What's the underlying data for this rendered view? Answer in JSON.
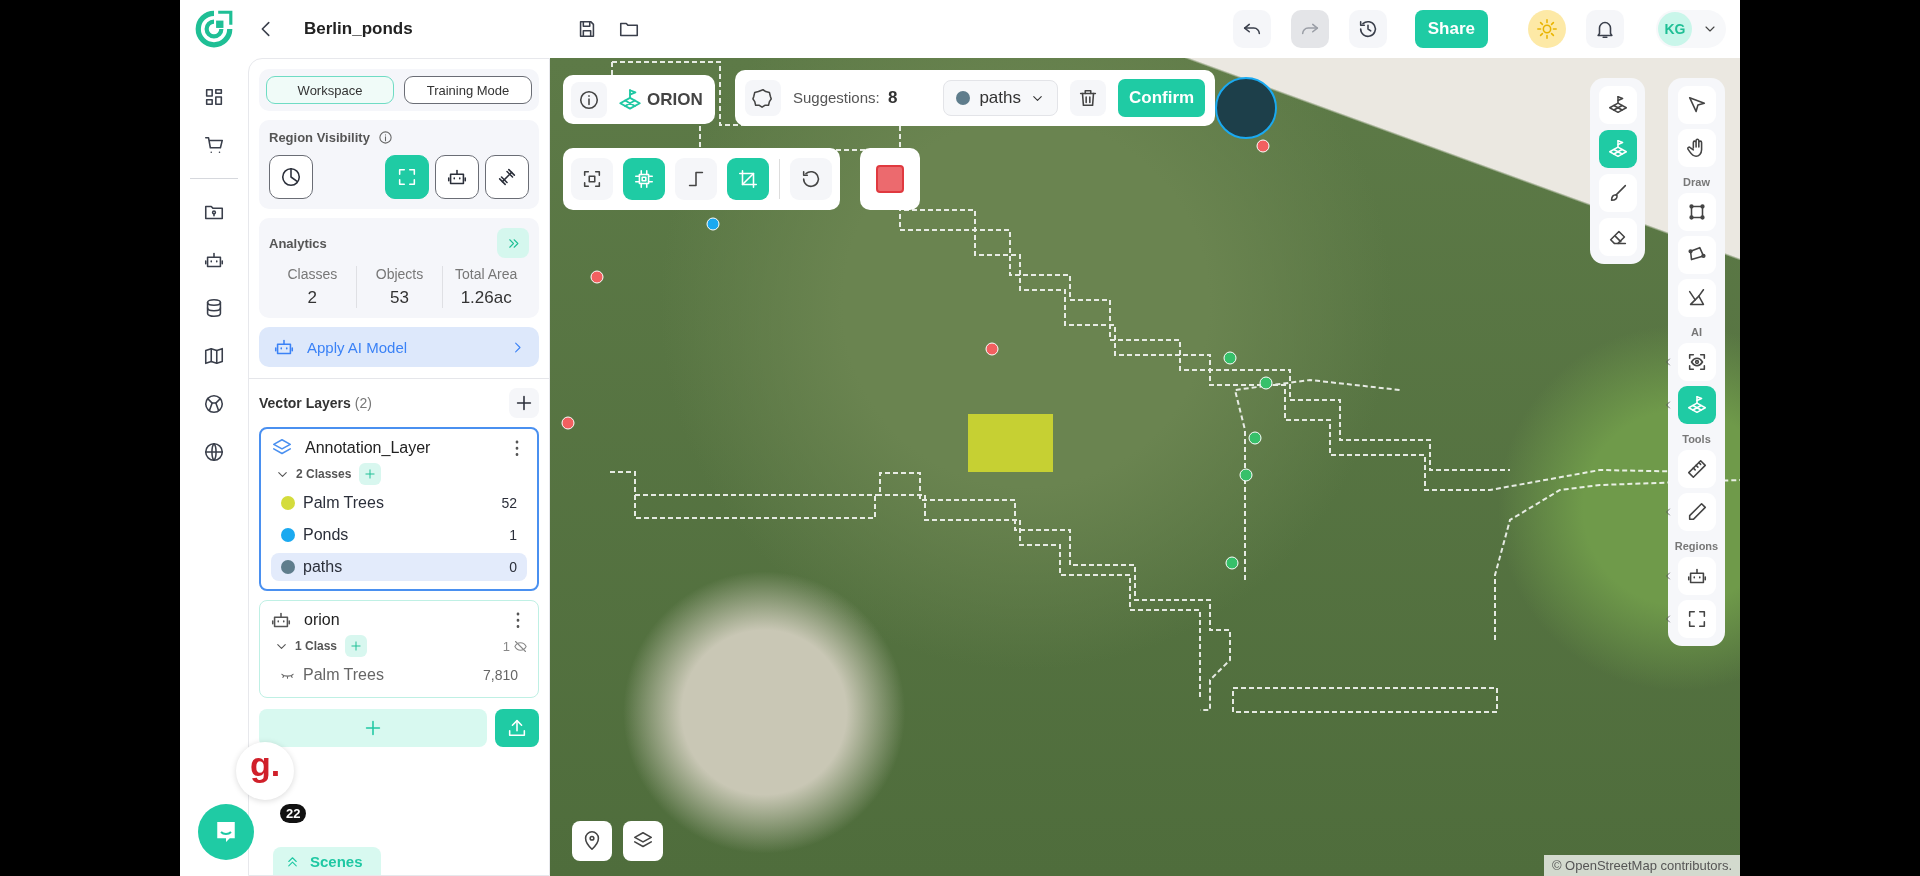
{
  "header": {
    "title": "Berlin_ponds"
  },
  "top_bar": {
    "actions": [
      {
        "kind": "undo",
        "disabled": false
      },
      {
        "kind": "redo",
        "disabled": true
      },
      {
        "kind": "history",
        "disabled": false
      }
    ],
    "share": "Share",
    "avatar": "KG"
  },
  "mode_tabs": [
    {
      "label": "Workspace",
      "selected": true
    },
    {
      "label": "Training Mode",
      "selected": false
    }
  ],
  "region_visibility": {
    "title": "Region Visibility",
    "tools": [
      {
        "kind": "pie",
        "selected": false
      },
      {
        "kind": "frame",
        "selected": true
      },
      {
        "kind": "robot",
        "selected": false
      },
      {
        "kind": "dumbbell",
        "selected": false
      }
    ]
  },
  "analytics": {
    "title": "Analytics",
    "stats": [
      {
        "label": "Classes",
        "value": "2"
      },
      {
        "label": "Objects",
        "value": "53"
      },
      {
        "label": "Total Area",
        "value": "1.26ac"
      }
    ]
  },
  "apply_model": {
    "label": "Apply AI Model"
  },
  "vector_layers": {
    "title": "Vector Layers",
    "count": "(2)",
    "layers": [
      {
        "kind": "annotation",
        "name": "Annotation_Layer",
        "selected": true,
        "class_count": "2 Classes",
        "classes": [
          {
            "name": "Palm Trees",
            "count": "52",
            "color": "#d4dc3c",
            "hidden": false,
            "selected": false
          },
          {
            "name": "Ponds",
            "count": "1",
            "color": "#1aa9f0",
            "hidden": false,
            "selected": false
          },
          {
            "name": "paths",
            "count": "0",
            "color": "#5f7d8c",
            "hidden": false,
            "selected": true
          }
        ]
      },
      {
        "kind": "model",
        "name": "orion",
        "selected": false,
        "class_count": "1 Class",
        "hidden_count": "1",
        "classes": [
          {
            "name": "Palm Trees",
            "count": "7,810",
            "hidden": true,
            "selected": false
          }
        ]
      }
    ]
  },
  "scenes": {
    "label": "Scenes"
  },
  "chat": {
    "extension_letter": "g.",
    "count": "22"
  },
  "map": {
    "orion": {
      "label": "ORION"
    },
    "suggestions": {
      "label": "Suggestions:",
      "count": "8",
      "class_select": {
        "label": "paths",
        "color": "#5f7d8c"
      },
      "confirm": "Confirm"
    },
    "tools": [
      {
        "kind": "focus",
        "selected": false
      },
      {
        "kind": "chip",
        "selected": true
      },
      {
        "kind": "step",
        "selected": false
      },
      {
        "kind": "crop",
        "selected": true
      },
      {
        "kind": "rotate",
        "selected": false
      }
    ],
    "side_tools": [
      {
        "kind": "flag",
        "selected": false
      },
      {
        "kind": "flag",
        "selected": true
      },
      {
        "kind": "brush",
        "selected": false
      },
      {
        "kind": "eraser",
        "selected": false
      }
    ],
    "toolbar_groups": [
      {
        "tools": [
          {
            "kind": "pointer",
            "selected": false,
            "submenu": false
          },
          {
            "kind": "hand",
            "selected": false,
            "submenu": false
          }
        ]
      },
      {
        "title": "Draw",
        "tools": [
          {
            "kind": "rect",
            "selected": false,
            "submenu": false
          },
          {
            "kind": "polygon",
            "selected": false,
            "submenu": false
          },
          {
            "kind": "polyline",
            "selected": false,
            "submenu": false
          }
        ]
      },
      {
        "title": "AI",
        "tools": [
          {
            "kind": "eyescan",
            "selected": false,
            "submenu": true
          },
          {
            "kind": "flag",
            "selected": true,
            "submenu": true
          }
        ]
      },
      {
        "title": "Tools",
        "tools": [
          {
            "kind": "ruler",
            "selected": false,
            "submenu": false
          },
          {
            "kind": "pen",
            "selected": false,
            "submenu": true
          }
        ]
      },
      {
        "title": "Regions",
        "tools": [
          {
            "kind": "robot",
            "selected": false,
            "submenu": true
          },
          {
            "kind": "frame",
            "selected": false,
            "submenu": true
          }
        ]
      }
    ],
    "attribution": "© OpenStreetMap contributors."
  }
}
